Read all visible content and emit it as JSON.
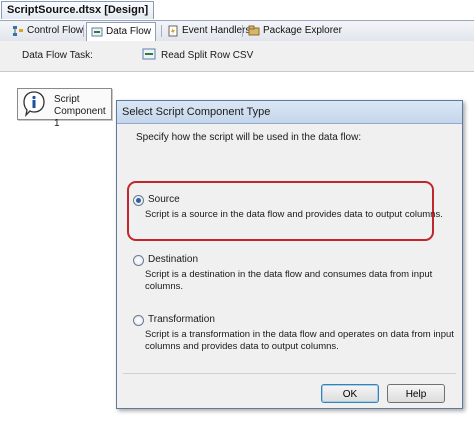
{
  "document": {
    "title": "ScriptSource.dtsx [Design]"
  },
  "tabs": [
    {
      "label": "Control Flow",
      "icon": "control-flow-icon"
    },
    {
      "label": "Data Flow",
      "icon": "data-flow-icon",
      "active": true
    },
    {
      "label": "Event Handlers",
      "icon": "event-handlers-icon"
    },
    {
      "label": "Package Explorer",
      "icon": "package-explorer-icon"
    }
  ],
  "task_bar": {
    "label": "Data Flow Task:",
    "value": "Read Split Row CSV"
  },
  "component": {
    "line1": "Script",
    "line2": "Component 1"
  },
  "dialog": {
    "title": "Select Script Component Type",
    "prompt": "Specify how the script will be used in the data flow:",
    "options": [
      {
        "label": "Source",
        "description": "Script is a source in the data flow and provides data to output columns.",
        "checked": true
      },
      {
        "label": "Destination",
        "description": "Script is a destination in the data flow and consumes data from input columns.",
        "checked": false
      },
      {
        "label": "Transformation",
        "description": "Script is a transformation in the data flow and operates on data from input columns and provides data to output columns.",
        "checked": false
      }
    ],
    "ok_label": "OK",
    "help_label": "Help"
  },
  "colors": {
    "highlight": "#c0262c",
    "dialog_title": "#c4d6ec"
  }
}
